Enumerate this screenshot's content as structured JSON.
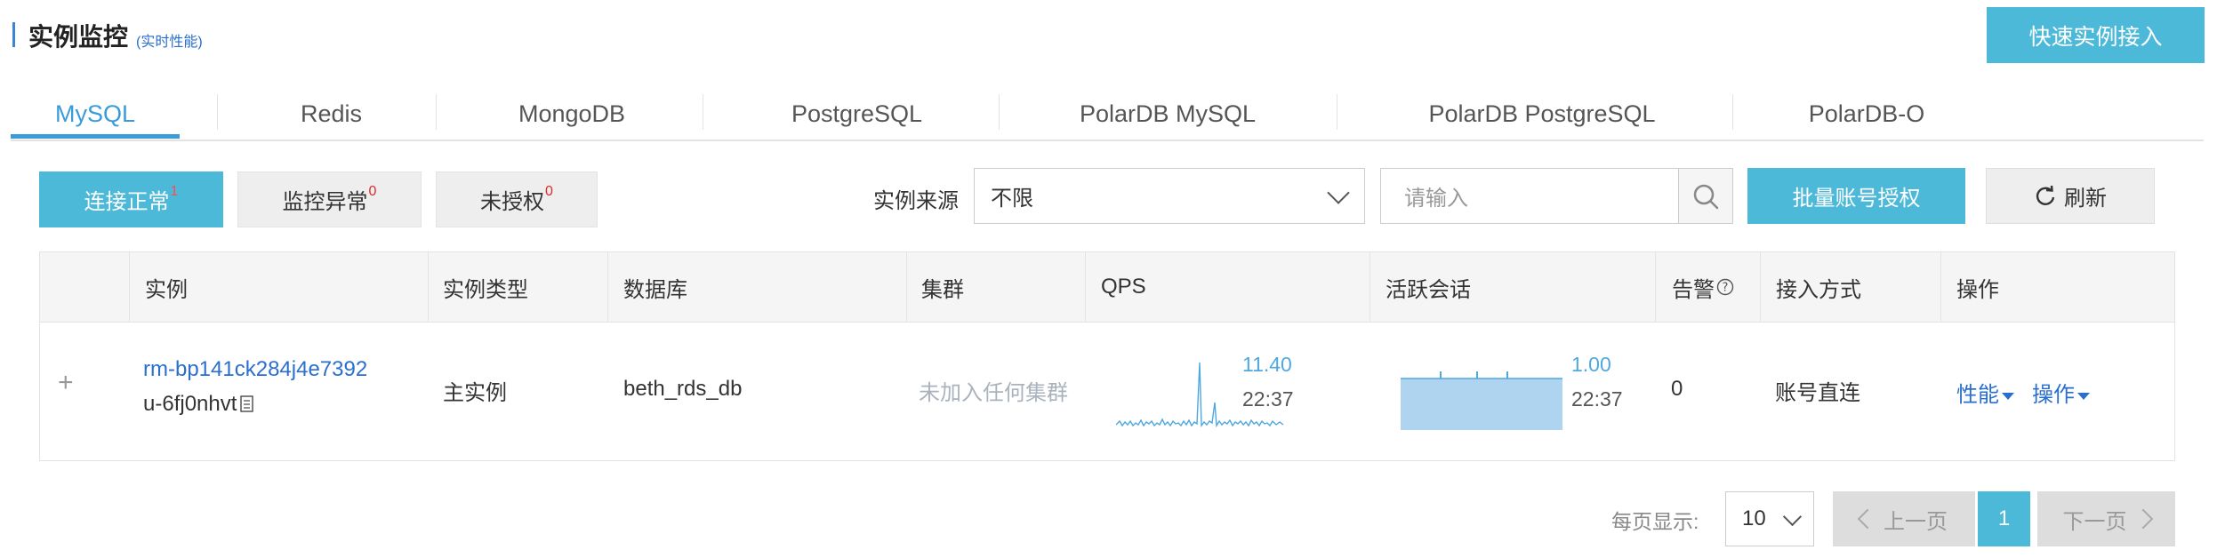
{
  "header": {
    "title": "实例监控",
    "subtitle": "(实时性能)",
    "quick_connect_label": "快速实例接入"
  },
  "tabs": [
    "MySQL",
    "Redis",
    "MongoDB",
    "PostgreSQL",
    "PolarDB MySQL",
    "PolarDB PostgreSQL",
    "PolarDB-O"
  ],
  "active_tab": "MySQL",
  "filters": {
    "connected": {
      "label": "连接正常",
      "count": "1"
    },
    "monitor_error": {
      "label": "监控异常",
      "count": "0"
    },
    "unauthorized": {
      "label": "未授权",
      "count": "0"
    },
    "source_label": "实例来源",
    "source_value": "不限",
    "search_placeholder": "请输入",
    "batch_auth_label": "批量账号授权",
    "refresh_label": "刷新"
  },
  "table": {
    "columns": [
      "实例",
      "实例类型",
      "数据库",
      "集群",
      "QPS",
      "活跃会话",
      "告警",
      "接入方式",
      "操作"
    ],
    "rows": [
      {
        "expand": "+",
        "instance_id": "rm-bp141ck284j4e7392",
        "instance_sub": "u-6fj0nhvt",
        "type": "主实例",
        "database": "beth_rds_db",
        "cluster": "未加入任何集群",
        "qps_value": "11.40",
        "qps_time": "22:37",
        "session_value": "1.00",
        "session_time": "22:37",
        "alerts": "0",
        "access": "账号直连",
        "perf_action": "性能",
        "ops_action": "操作"
      }
    ]
  },
  "pagination": {
    "page_size_label": "每页显示:",
    "page_size": "10",
    "prev_label": "上一页",
    "current_page": "1",
    "next_label": "下一页"
  },
  "colors": {
    "accent": "#4cb9d9",
    "link": "#2a6fd0",
    "chart_fill": "#aed4f0",
    "chart_line": "#4fa8e0",
    "badge_red": "#e02a2a"
  }
}
